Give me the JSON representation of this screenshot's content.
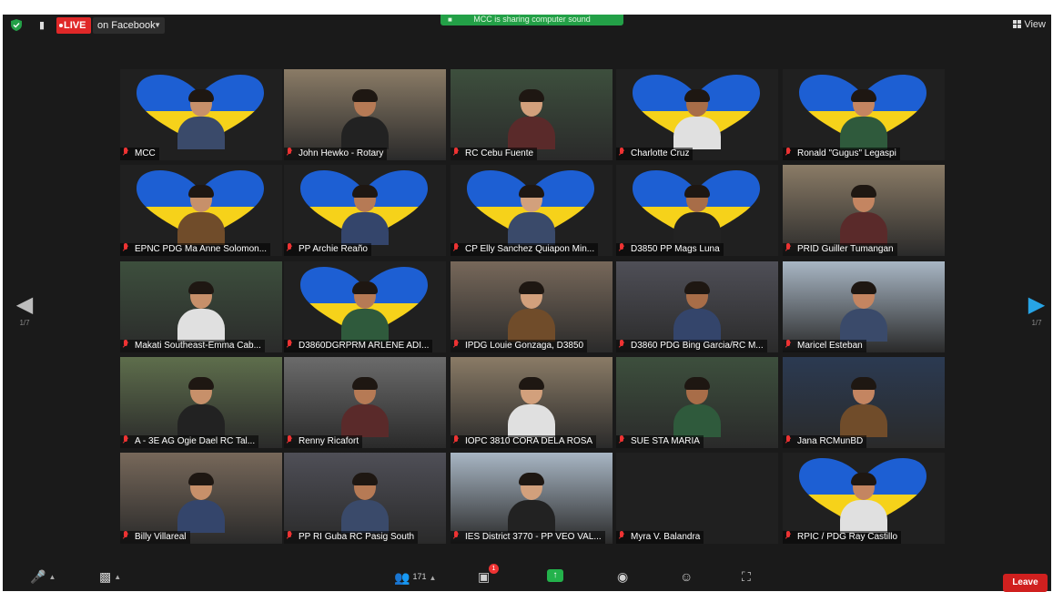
{
  "topbar": {
    "live_label": "LIVE",
    "stream_target": "on Facebook",
    "notice_text": "MCC is sharing computer sound",
    "view_label": "View"
  },
  "pager": {
    "prev_page": "1/7",
    "next_page": "1/7"
  },
  "tiles": [
    {
      "name": "MCC",
      "flag": true
    },
    {
      "name": "John Hewko - Rotary",
      "flag": false,
      "active": true
    },
    {
      "name": "RC Cebu Fuente",
      "flag": false
    },
    {
      "name": "Charlotte Cruz",
      "flag": true
    },
    {
      "name": "Ronald \"Gugus\" Legaspi",
      "flag": true
    },
    {
      "name": "EPNC PDG Ma Anne Solomon...",
      "flag": true
    },
    {
      "name": "PP Archie Reaño",
      "flag": true
    },
    {
      "name": "CP Elly Sanchez Quiapon Min...",
      "flag": true
    },
    {
      "name": "D3850 PP Mags Luna",
      "flag": true
    },
    {
      "name": "PRID Guiller Tumangan",
      "flag": false
    },
    {
      "name": "Makati Southeast-Emma Cab...",
      "flag": false
    },
    {
      "name": "D3860DGRPRM ARLENE ADI...",
      "flag": true
    },
    {
      "name": "IPDG Louie Gonzaga, D3850",
      "flag": false
    },
    {
      "name": "D3860 PDG Bing Garcia/RC M...",
      "flag": false
    },
    {
      "name": "Maricel Esteban",
      "flag": false
    },
    {
      "name": "A - 3E AG Ogie Dael RC Tal...",
      "flag": false
    },
    {
      "name": "Renny Ricafort",
      "flag": false
    },
    {
      "name": "IOPC 3810 CORA DELA ROSA",
      "flag": false
    },
    {
      "name": "SUE STA MARIA",
      "flag": false
    },
    {
      "name": "Jana RCMunBD",
      "flag": false
    },
    {
      "name": "Billy Villareal",
      "flag": false
    },
    {
      "name": "PP RI Guba RC Pasig South",
      "flag": false
    },
    {
      "name": "IES District 3770 - PP VEO VAL...",
      "flag": false
    },
    {
      "name": "Myra V. Balandra",
      "flag": false
    },
    {
      "name": "RPIC / PDG Ray Castillo",
      "flag": true
    }
  ],
  "toolbar": {
    "participants_count": "171",
    "chat_badge": "1",
    "leave_label": "Leave"
  },
  "colors": {
    "flag_blue": "#1d5fd3",
    "flag_yellow": "#f6d21a",
    "live_red": "#e02828",
    "active_border": "#a6d64a",
    "leave_red": "#d0201f",
    "share_green": "#23b24b"
  }
}
